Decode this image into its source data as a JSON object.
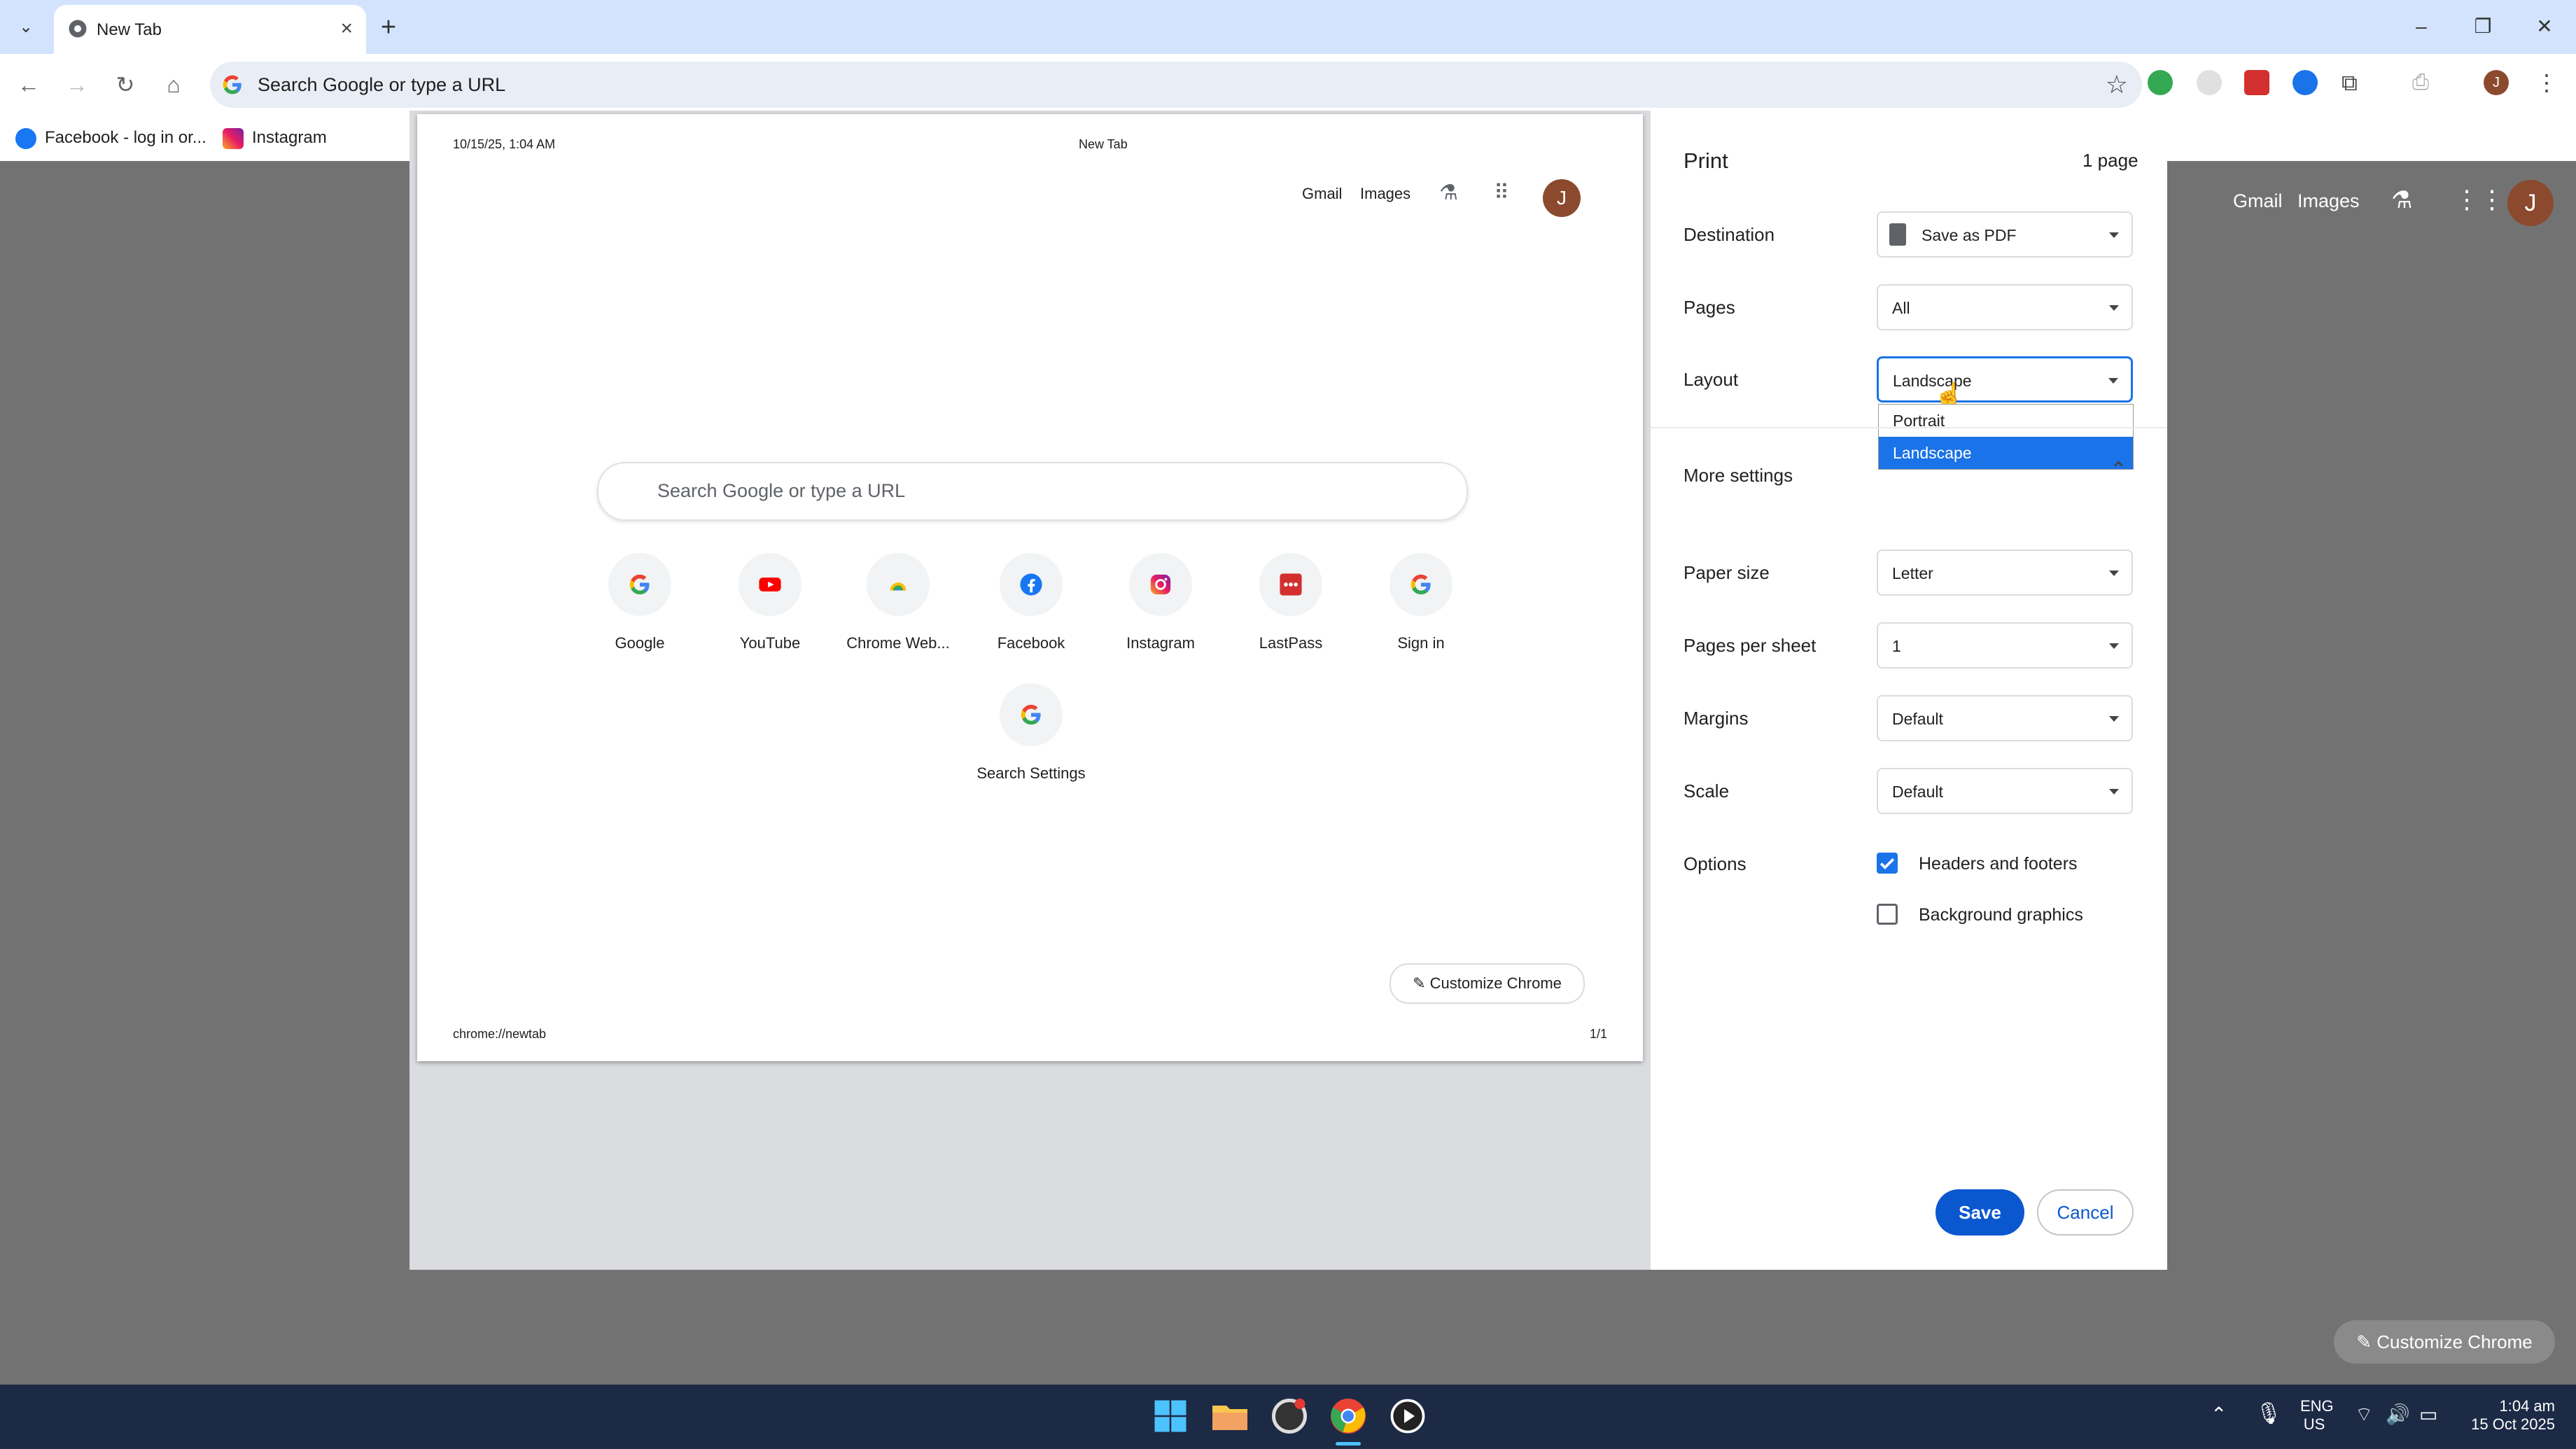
{
  "browser": {
    "tab_title": "New Tab",
    "omnibox_placeholder": "Search Google or type a URL",
    "bookmarks": [
      {
        "label": "Facebook - log in or...",
        "icon": "facebook-icon"
      },
      {
        "label": "Instagram",
        "icon": "instagram-icon"
      }
    ]
  },
  "background_ntp": {
    "gmail": "Gmail",
    "images": "Images",
    "avatar_letter": "J",
    "customize": "Customize Chrome"
  },
  "preview": {
    "header_date": "10/15/25, 1:04 AM",
    "header_title": "New Tab",
    "gmail": "Gmail",
    "images": "Images",
    "avatar_letter": "J",
    "search_placeholder": "Search Google or type a URL",
    "shortcuts": [
      {
        "label": "Google",
        "icon": "google-icon"
      },
      {
        "label": "YouTube",
        "icon": "youtube-icon"
      },
      {
        "label": "Chrome Web...",
        "icon": "chrome-web-store-icon"
      },
      {
        "label": "Facebook",
        "icon": "facebook-icon"
      },
      {
        "label": "Instagram",
        "icon": "instagram-icon"
      },
      {
        "label": "LastPass",
        "icon": "lastpass-icon"
      },
      {
        "label": "Sign in",
        "icon": "google-icon"
      },
      {
        "label": "Search Settings",
        "icon": "google-icon"
      }
    ],
    "customize": "Customize Chrome",
    "footer_url": "chrome://newtab",
    "footer_page": "1/1"
  },
  "print": {
    "title": "Print",
    "page_count": "1 page",
    "destination_label": "Destination",
    "destination_value": "Save as PDF",
    "pages_label": "Pages",
    "pages_value": "All",
    "layout_label": "Layout",
    "layout_value": "Landscape",
    "layout_options": [
      "Portrait",
      "Landscape"
    ],
    "more_settings": "More settings",
    "paper_size_label": "Paper size",
    "paper_size_value": "Letter",
    "pages_per_sheet_label": "Pages per sheet",
    "pages_per_sheet_value": "1",
    "margins_label": "Margins",
    "margins_value": "Default",
    "scale_label": "Scale",
    "scale_value": "Default",
    "options_label": "Options",
    "opt_headers": "Headers and footers",
    "opt_background": "Background graphics",
    "save": "Save",
    "cancel": "Cancel"
  },
  "taskbar": {
    "lang_top": "ENG",
    "lang_bottom": "US",
    "time": "1:04 am",
    "date": "15 Oct 2025"
  },
  "colors": {
    "accent": "#1a73e8",
    "save": "#0b57d0",
    "taskbar": "#1c2a45"
  }
}
